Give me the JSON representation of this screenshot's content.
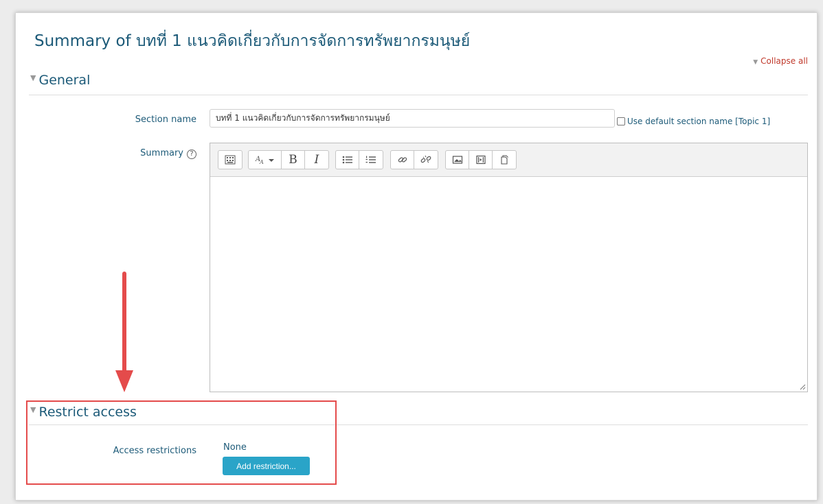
{
  "page": {
    "title": "Summary of บทที่ 1 แนวคิดเกี่ยวกับการจัดการทรัพยากรมนุษย์",
    "collapse_all": "Collapse all"
  },
  "general": {
    "heading": "General",
    "section_name_label": "Section name",
    "section_name_value": "บทที่ 1 แนวคิดเกี่ยวกับการจัดการทรัพยากรมนุษย์",
    "use_default_label": "Use default section name [Topic 1]",
    "summary_label": "Summary",
    "toolbar": {
      "bold": "B",
      "italic": "I"
    }
  },
  "restrict": {
    "heading": "Restrict access",
    "access_label": "Access restrictions",
    "none_text": "None",
    "add_button": "Add restriction..."
  },
  "colors": {
    "title": "#1c5a78",
    "link_red": "#c0392b",
    "button_blue": "#2aa4c8",
    "highlight_red": "#e44b4b"
  }
}
